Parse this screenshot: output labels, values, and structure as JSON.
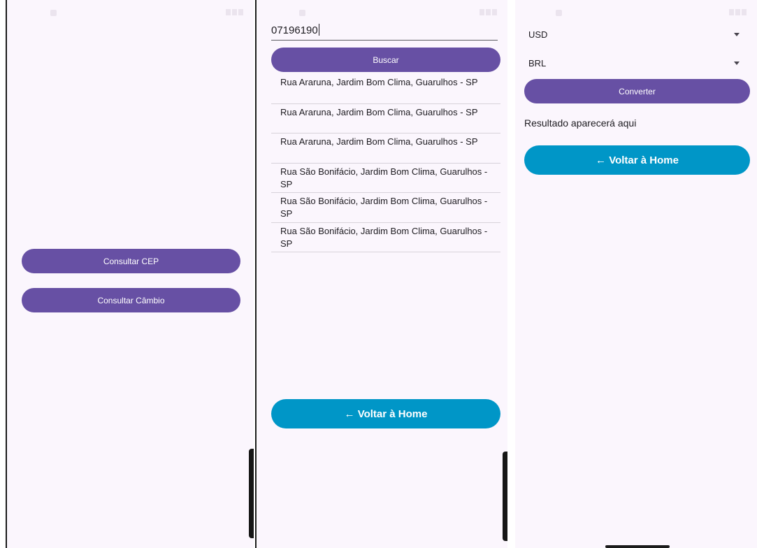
{
  "home": {
    "buttons": {
      "consultar_cep": "Consultar CEP",
      "consultar_cambio": "Consultar Câmbio"
    }
  },
  "cep": {
    "input_value": "07196190",
    "buscar_label": "Buscar",
    "results": [
      "Rua Araruna, Jardim Bom Clima, Guarulhos - SP",
      "Rua Araruna, Jardim Bom Clima, Guarulhos - SP",
      "Rua Araruna, Jardim Bom Clima, Guarulhos - SP",
      "Rua São Bonifácio, Jardim Bom Clima, Guarulhos - SP",
      "Rua São Bonifácio, Jardim Bom Clima, Guarulhos - SP",
      "Rua São Bonifácio, Jardim Bom Clima, Guarulhos - SP"
    ],
    "voltar_label": "← Voltar à Home"
  },
  "cambio": {
    "from_currency": "USD",
    "to_currency": "BRL",
    "converter_label": "Converter",
    "result_placeholder": "Resultado aparecerá aqui",
    "voltar_label": "← Voltar à Home"
  },
  "icons": {
    "statusbar_icons": "statusbar-icon",
    "dropdown": "chevron-down-icon"
  },
  "colors": {
    "primary": "#6750a4",
    "accent": "#0096c7",
    "background": "#fbf6fd"
  }
}
